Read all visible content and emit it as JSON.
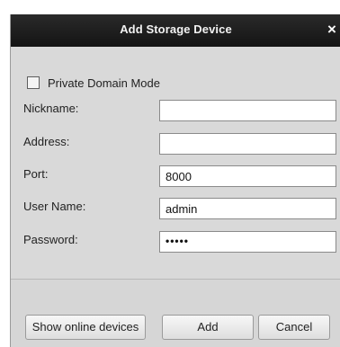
{
  "dialog": {
    "title": "Add Storage Device",
    "close_glyph": "×"
  },
  "form": {
    "private_domain_mode": {
      "label": "Private Domain Mode",
      "checked": false
    },
    "nickname": {
      "label": "Nickname:",
      "value": ""
    },
    "address": {
      "label": "Address:",
      "value": ""
    },
    "port": {
      "label": "Port:",
      "value": "8000"
    },
    "user_name": {
      "label": "User Name:",
      "value": "admin"
    },
    "password": {
      "label": "Password:",
      "value": "•••••"
    }
  },
  "buttons": {
    "show_online_devices": "Show online devices",
    "add": "Add",
    "cancel": "Cancel"
  }
}
